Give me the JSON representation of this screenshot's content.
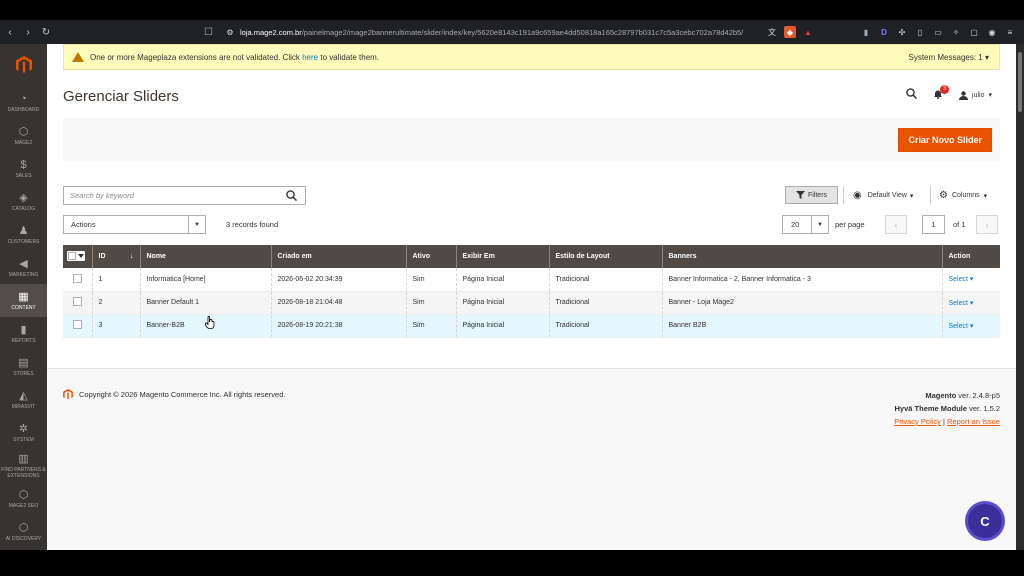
{
  "browser": {
    "back": "‹",
    "forward": "›",
    "reload": "↻",
    "url_host": "loja.mage2.com.br",
    "url_path": "/painelmage2/mage2bannerultimate/slider/index/key/5620e8143c191a9c659ae4dd50818a165c28797b031c7c5a3cebc702a78d42b5/"
  },
  "sidebar": {
    "items": [
      {
        "label": "Dashboard",
        "glyph": "◔"
      },
      {
        "label": "Mage2",
        "glyph": "⬡"
      },
      {
        "label": "Sales",
        "glyph": "$"
      },
      {
        "label": "Catalog",
        "glyph": "◈"
      },
      {
        "label": "Customers",
        "glyph": "♟"
      },
      {
        "label": "Marketing",
        "glyph": "◀"
      },
      {
        "label": "Content",
        "glyph": "▦"
      },
      {
        "label": "Reports",
        "glyph": "▮"
      },
      {
        "label": "Stores",
        "glyph": "▤"
      },
      {
        "label": "Mirasvit",
        "glyph": "◭"
      },
      {
        "label": "System",
        "glyph": "✲"
      },
      {
        "label": "Find Partners & Extensions",
        "glyph": "▥"
      },
      {
        "label": "Mage2 SEO",
        "glyph": "⬡"
      },
      {
        "label": "AI Discovery",
        "glyph": "⬡"
      }
    ],
    "active": "Content"
  },
  "message": {
    "text_before": "One or more Mageplaza extensions are not validated. Click ",
    "link": "here",
    "text_after": " to validate them.",
    "system_messages": "System Messages: 1"
  },
  "header": {
    "title": "Gerenciar Sliders",
    "notifications_count": "3",
    "user": "julio"
  },
  "action_bar": {
    "create_button": "Criar Novo Slider"
  },
  "toolbar": {
    "search_placeholder": "Search by keyword",
    "filters": "Filters",
    "default_view": "Default View",
    "columns": "Columns",
    "actions": "Actions",
    "records": "3 records found",
    "per_page_value": "20",
    "per_page_label": "per page",
    "page_current": "1",
    "page_of": "of 1"
  },
  "table": {
    "columns": [
      "ID",
      "Nome",
      "Criado em",
      "Ativo",
      "Exibir Em",
      "Estilo de Layout",
      "Banners",
      "Action"
    ],
    "rows": [
      {
        "id": "1",
        "nome": "Informatica [Home]",
        "criado": "2026-06-02 20:34:39",
        "ativo": "Sim",
        "exibir": "Página Inicial",
        "estilo": "Tradicional",
        "banners": "Banner Informatica - 2, Banner Informatica - 3",
        "action": "Select"
      },
      {
        "id": "2",
        "nome": "Banner Default 1",
        "criado": "2026-08-18 21:04:48",
        "ativo": "Sim",
        "exibir": "Página Inicial",
        "estilo": "Tradicional",
        "banners": "Banner - Loja Mage2",
        "action": "Select"
      },
      {
        "id": "3",
        "nome": "Banner-B2B",
        "criado": "2026-08-19 20:21:38",
        "ativo": "Sim",
        "exibir": "Página Inicial",
        "estilo": "Tradicional",
        "banners": "Banner B2B",
        "action": "Select"
      }
    ]
  },
  "footer": {
    "copyright": "Copyright © 2026 Magento Commerce Inc. All rights reserved.",
    "magento_label": "Magento",
    "magento_version": "ver. 2.4.8-p5",
    "hyva_label": "Hyvä Theme Module",
    "hyva_version": "ver. 1.5.2",
    "privacy": "Privacy Policy",
    "separator": "|",
    "report": "Report an Issue"
  },
  "chat": {
    "letter": "C"
  },
  "colors": {
    "accent": "#eb5202",
    "sidebar_bg": "#373330",
    "table_header": "#514943",
    "link": "#007bdb",
    "message_bg": "#fffbbb"
  }
}
